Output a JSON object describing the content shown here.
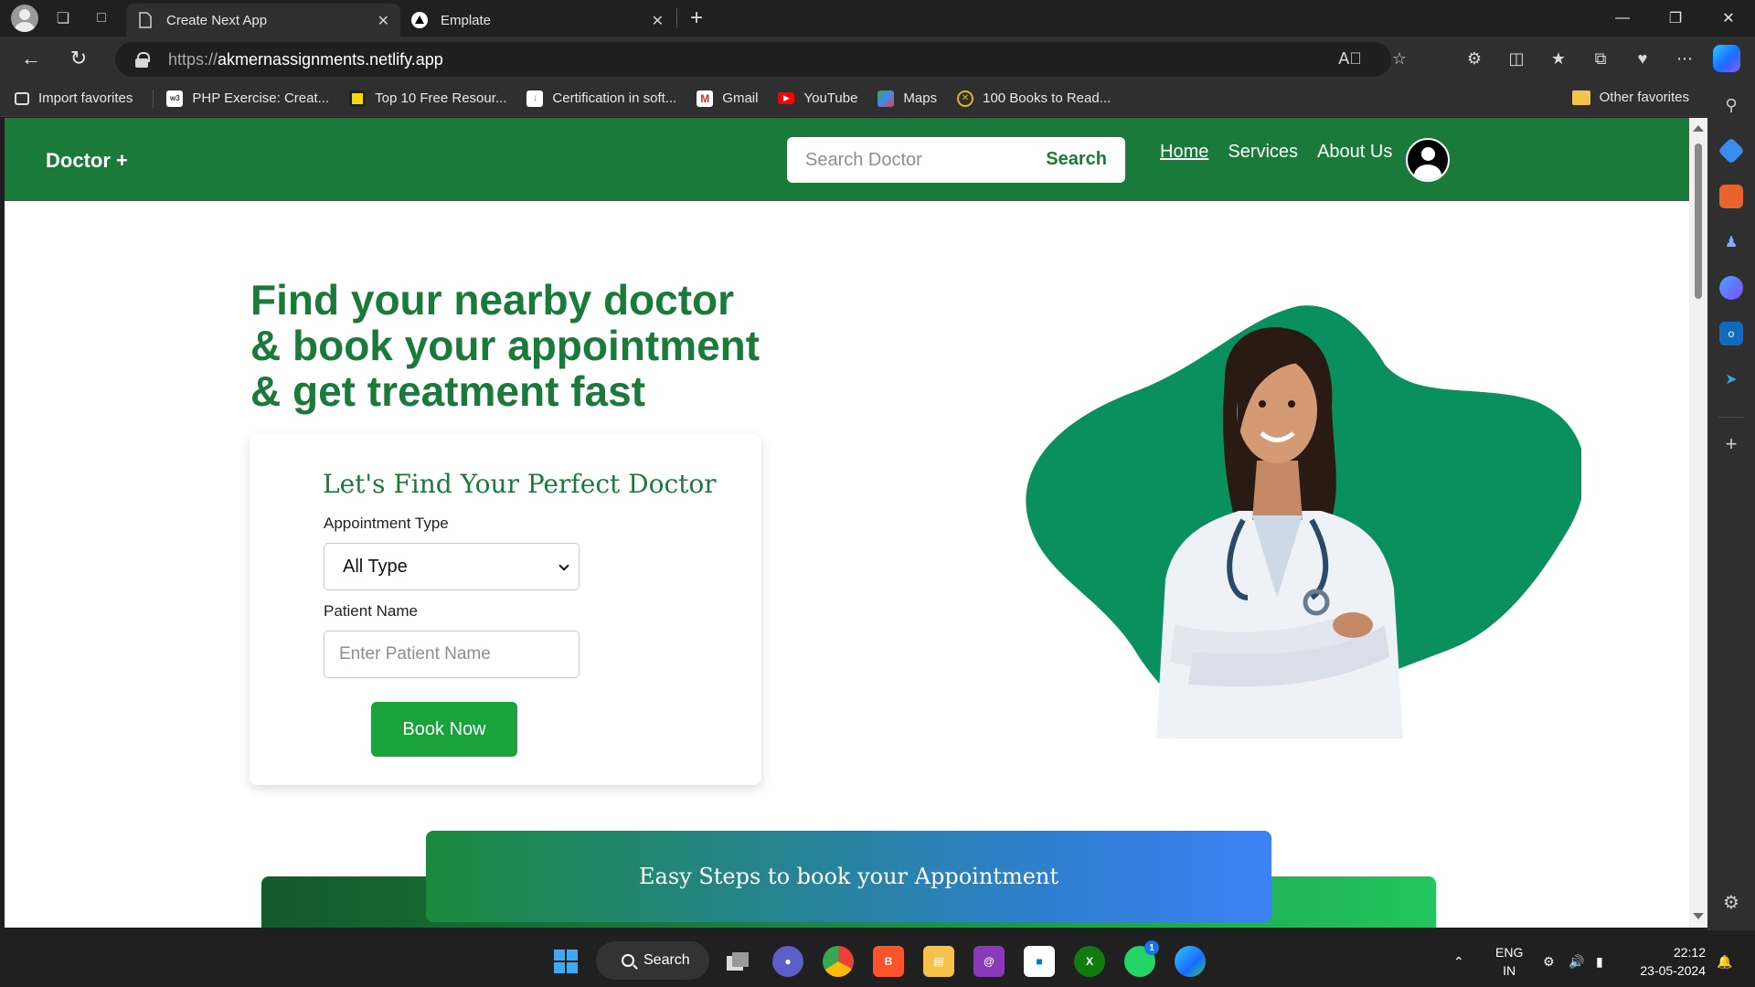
{
  "browser": {
    "tabs": [
      {
        "title": "Create Next App",
        "active": true
      },
      {
        "title": "Emplate",
        "active": false
      }
    ],
    "url_protocol": "https://",
    "url_host": "akmernassignments.netlify.app",
    "bookmarks": [
      {
        "label": "Import favorites",
        "icon": "import-icon"
      },
      {
        "label": "PHP Exercise: Creat...",
        "icon": "w3schools-icon"
      },
      {
        "label": "Top 10 Free Resour...",
        "icon": "bookmark-yellow-icon"
      },
      {
        "label": "Certification in soft...",
        "icon": "document-icon"
      },
      {
        "label": "Gmail",
        "icon": "gmail-icon"
      },
      {
        "label": "YouTube",
        "icon": "youtube-icon"
      },
      {
        "label": "Maps",
        "icon": "maps-icon"
      },
      {
        "label": "100 Books to Read...",
        "icon": "books-icon"
      }
    ],
    "other_favorites": "Other favorites"
  },
  "site": {
    "brand": "Doctor +",
    "search_placeholder": "Search Doctor",
    "search_button": "Search",
    "nav": [
      "Home",
      "Services",
      "About Us"
    ],
    "hero_lines": [
      "Find your nearby doctor",
      "& book your appointment",
      "& get treatment fast"
    ],
    "form": {
      "title": "Let's Find Your Perfect Doctor",
      "appointment_label": "Appointment Type",
      "appointment_value": "All Type",
      "patient_label": "Patient Name",
      "patient_placeholder": "Enter Patient Name",
      "submit": "Book Now"
    },
    "steps_title": "Easy Steps to book your Appointment",
    "colors": {
      "primary": "#1a7a3a",
      "blob": "#0a8f5f",
      "button": "#1aa33b"
    }
  },
  "taskbar": {
    "search_label": "Search",
    "lang_top": "ENG",
    "lang_bottom": "IN",
    "time": "22:12",
    "date": "23-05-2024",
    "whatsapp_badge": "1"
  }
}
